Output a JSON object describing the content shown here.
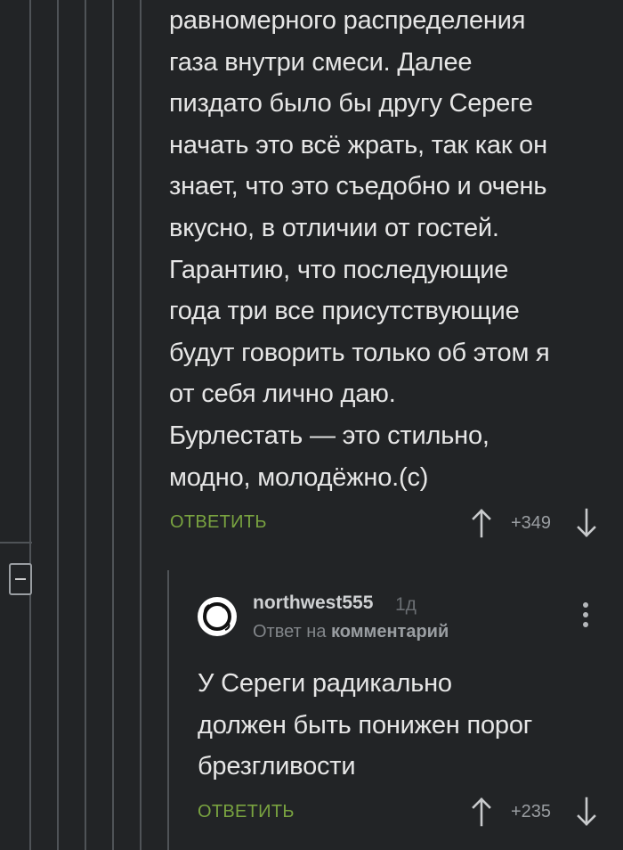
{
  "parent_comment": {
    "lines": [
      "равномерного распределения",
      "газа внутри смеси. Далее",
      "пиздато было бы другу Сереге",
      "начать это всё жрать, так как он",
      "знает, что это съедобно и очень",
      "вкусно, в отличии от гостей.",
      "Гарантию, что последующие",
      "года три все присутствующие",
      "будут говорить только об этом я",
      "от себя лично даю.",
      "Бурлестать — это стильно,",
      "модно, молодёжно.(с)"
    ],
    "reply_label": "ОТВЕТИТЬ",
    "score": "+349"
  },
  "reply_comment": {
    "username": "northwest555",
    "time": "1д",
    "reply_prefix": "Ответ на",
    "reply_target": "комментарий",
    "lines": [
      "У Сереги радикально",
      "должен быть понижен порог",
      "брезгливости"
    ],
    "reply_label": "ОТВЕТИТЬ",
    "score": "+235"
  },
  "icons": {
    "collapse": "minus-icon",
    "menu": "kebab-menu-icon",
    "upvote": "arrow-up-icon",
    "downvote": "arrow-down-icon"
  },
  "colors": {
    "background": "#222426",
    "text": "#e6e6e6",
    "accent_green": "#79a340",
    "muted": "#9a9ea2",
    "thread_line": "#4f5357"
  }
}
